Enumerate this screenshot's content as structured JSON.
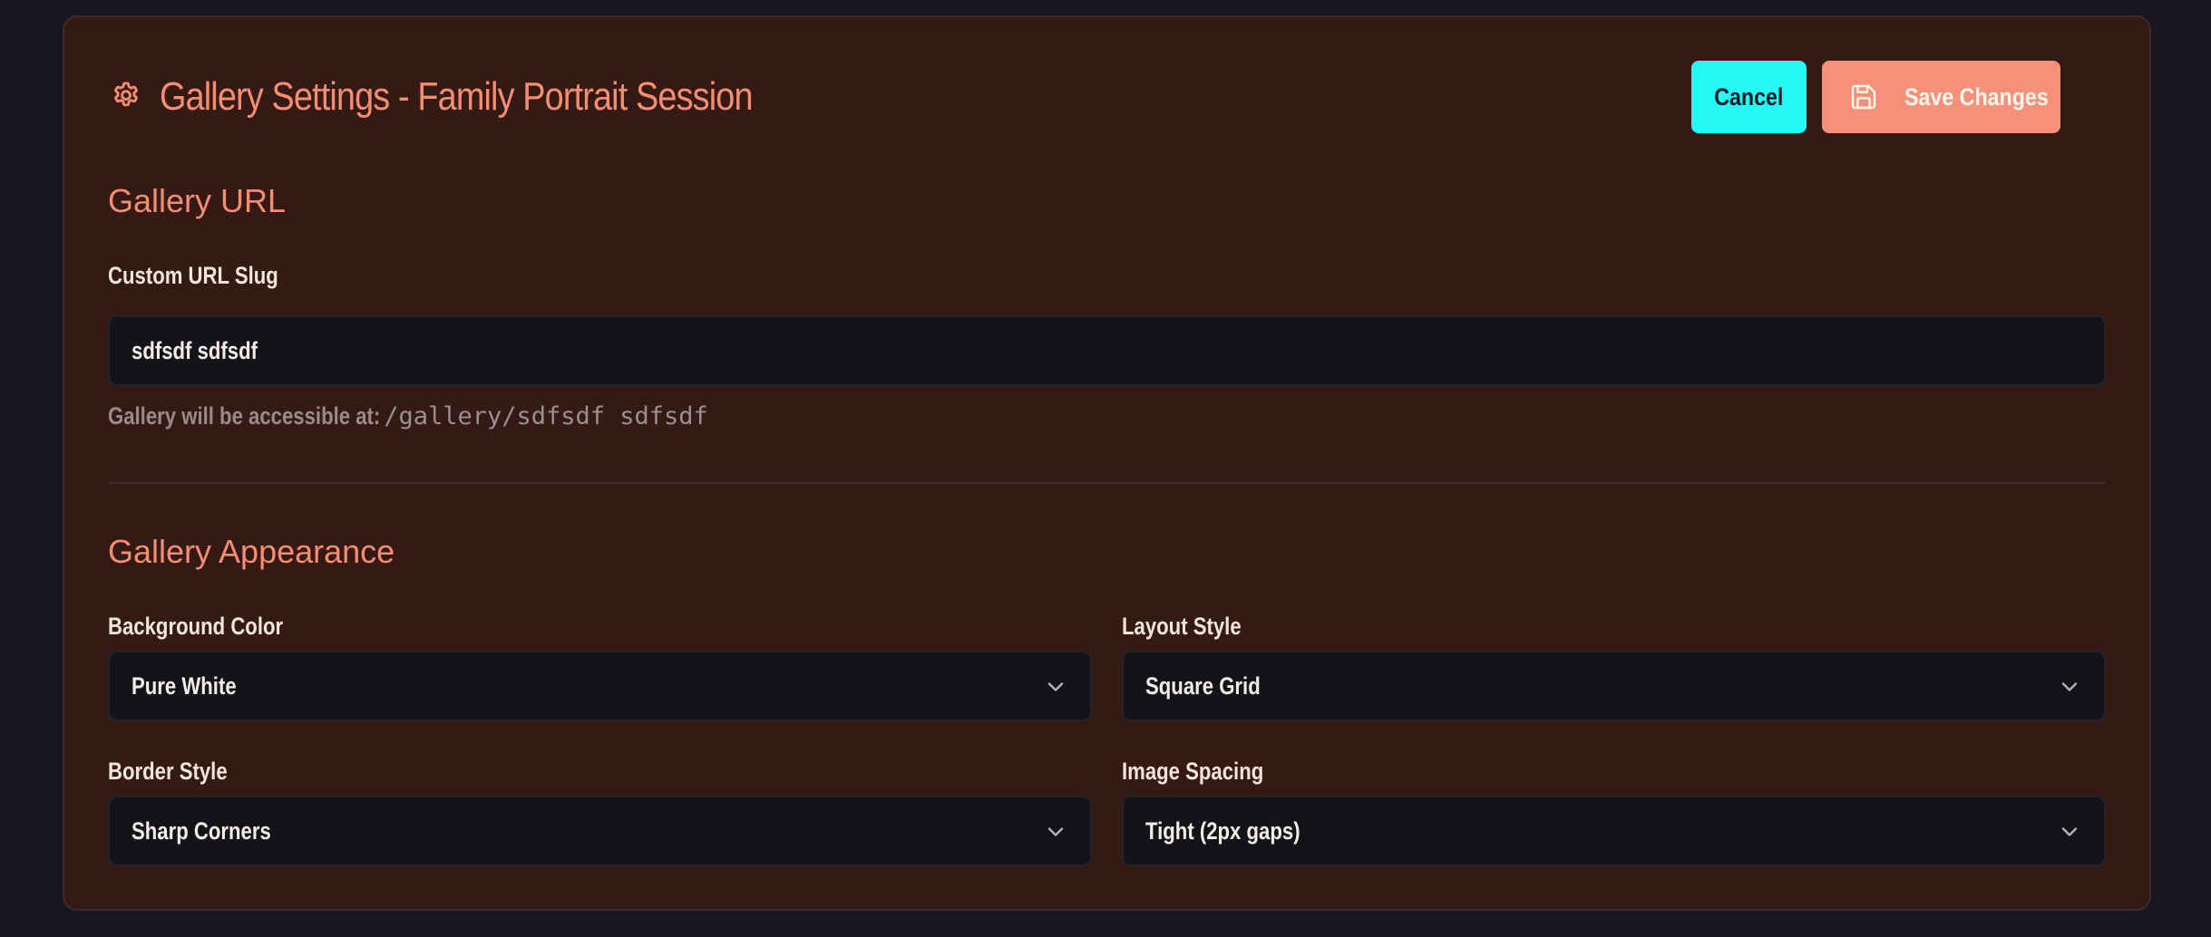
{
  "header": {
    "title": "Gallery Settings - Family Portrait Session",
    "cancel_label": "Cancel",
    "save_label": "Save Changes"
  },
  "url_section": {
    "title": "Gallery URL",
    "slug_label": "Custom URL Slug",
    "slug_value": "sdfsdf sdfsdf",
    "hint_text": "Gallery will be accessible at:",
    "hint_path": "/gallery/sdfsdf sdfsdf"
  },
  "appearance_section": {
    "title": "Gallery Appearance",
    "background_color_label": "Background Color",
    "background_color_value": "Pure White",
    "layout_style_label": "Layout Style",
    "layout_style_value": "Square Grid",
    "border_style_label": "Border Style",
    "border_style_value": "Sharp Corners",
    "image_spacing_label": "Image Spacing",
    "image_spacing_value": "Tight (2px gaps)"
  },
  "icons": {
    "title_icon": "gear-icon",
    "save_icon": "save-icon",
    "dropdown_icon": "chevron-down-icon"
  },
  "colors": {
    "page_bg": "#171622",
    "panel_bg": "#341915",
    "accent": "#f58d70",
    "cancel_bg": "#27f8f8",
    "save_bg": "#f5917a",
    "input_bg": "#13131a"
  }
}
